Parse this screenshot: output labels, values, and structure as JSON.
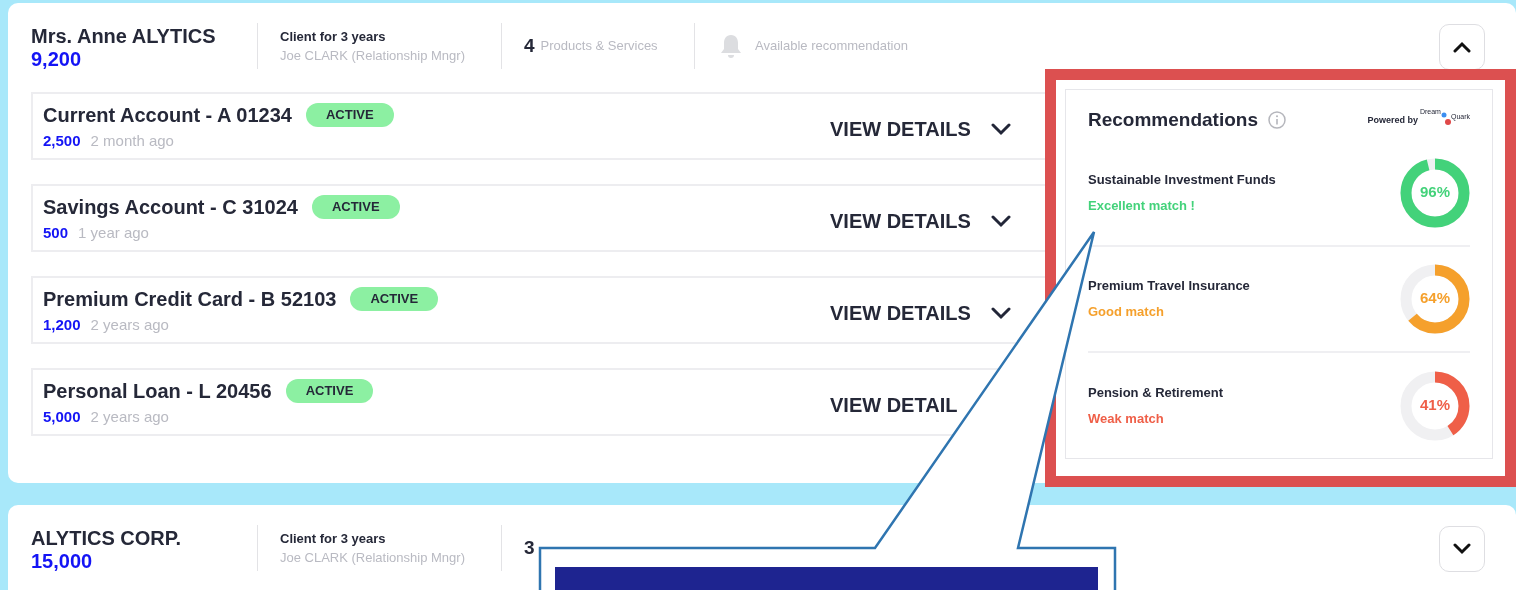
{
  "clients": [
    {
      "name": "Mrs. Anne ALYTICS",
      "amount": "9,200",
      "tenure": "Client for 3 years",
      "manager": "Joe CLARK (Relationship Mngr)",
      "products_count": "4",
      "products_label": "Products & Services",
      "recommendation_label": "Available recommendation",
      "expanded": true,
      "products": [
        {
          "title": "Current Account - A 01234",
          "status": "ACTIVE",
          "amount": "2,500",
          "age": "2 month ago",
          "action": "VIEW DETAILS",
          "chevron": true
        },
        {
          "title": "Savings Account - C 31024",
          "status": "ACTIVE",
          "amount": "500",
          "age": "1 year ago",
          "action": "VIEW DETAILS",
          "chevron": true
        },
        {
          "title": "Premium Credit Card - B 52103",
          "status": "ACTIVE",
          "amount": "1,200",
          "age": "2 years ago",
          "action": "VIEW DETAILS",
          "chevron": true
        },
        {
          "title": "Personal Loan - L 20456",
          "status": "ACTIVE",
          "amount": "5,000",
          "age": "2 years ago",
          "action": "VIEW DETAIL",
          "chevron": false
        }
      ]
    },
    {
      "name": "ALYTICS CORP.",
      "amount": "15,000",
      "tenure": "Client for 3 years",
      "manager": "Joe CLARK (Relationship Mngr)",
      "products_count": "3",
      "expanded": false
    }
  ],
  "recommendations": {
    "title": "Recommendations",
    "powered_by": "Powered by",
    "logo": [
      "Dream",
      "Quark"
    ],
    "items": [
      {
        "name": "Sustainable Investment Funds",
        "match": "Excellent match !",
        "color": "#43d27a",
        "percent": "96%"
      },
      {
        "name": "Premium Travel Insurance",
        "match": "Good match",
        "color": "#f5a02c",
        "percent": "64%"
      },
      {
        "name": "Pension & Retirement",
        "match": "Weak match",
        "color": "#ef5f48",
        "percent": "41%"
      }
    ]
  }
}
